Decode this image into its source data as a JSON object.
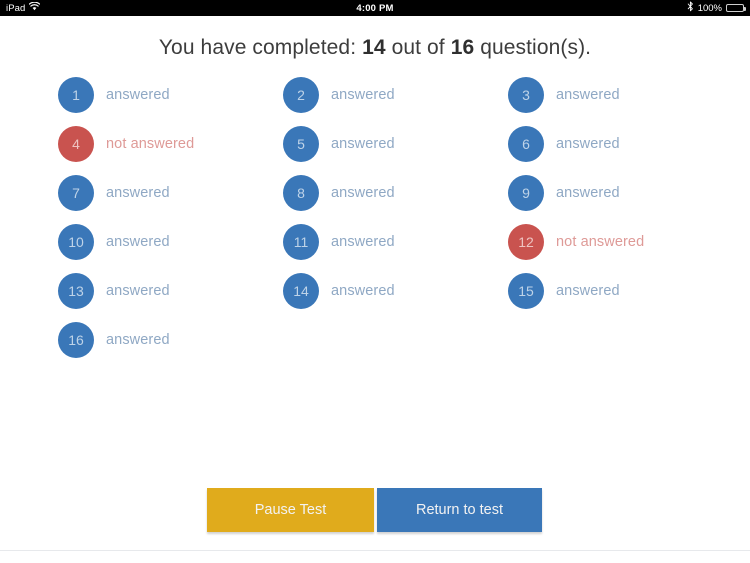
{
  "statusbar": {
    "device": "iPad",
    "wifi_icon": "wifi-icon",
    "time": "4:00 PM",
    "bluetooth_icon": "bluetooth-icon",
    "battery_percent": "100%",
    "battery_icon": "battery-full-icon"
  },
  "header": {
    "prefix": "You have completed:",
    "completed": "14",
    "middle": "out of",
    "total": "16",
    "suffix": "question(s)."
  },
  "questions": [
    {
      "number": "1",
      "status": "answered",
      "label": "answered"
    },
    {
      "number": "2",
      "status": "answered",
      "label": "answered"
    },
    {
      "number": "3",
      "status": "answered",
      "label": "answered"
    },
    {
      "number": "4",
      "status": "not_answered",
      "label": "not answered"
    },
    {
      "number": "5",
      "status": "answered",
      "label": "answered"
    },
    {
      "number": "6",
      "status": "answered",
      "label": "answered"
    },
    {
      "number": "7",
      "status": "answered",
      "label": "answered"
    },
    {
      "number": "8",
      "status": "answered",
      "label": "answered"
    },
    {
      "number": "9",
      "status": "answered",
      "label": "answered"
    },
    {
      "number": "10",
      "status": "answered",
      "label": "answered"
    },
    {
      "number": "11",
      "status": "answered",
      "label": "answered"
    },
    {
      "number": "12",
      "status": "not_answered",
      "label": "not answered"
    },
    {
      "number": "13",
      "status": "answered",
      "label": "answered"
    },
    {
      "number": "14",
      "status": "answered",
      "label": "answered"
    },
    {
      "number": "15",
      "status": "answered",
      "label": "answered"
    },
    {
      "number": "16",
      "status": "answered",
      "label": "answered"
    }
  ],
  "actions": {
    "pause_label": "Pause Test",
    "return_label": "Return to test"
  },
  "colors": {
    "answered_bubble": "#3a77b8",
    "not_answered_bubble": "#c9534f",
    "answered_text": "#8fa8c4",
    "not_answered_text": "#de9a97",
    "pause_button": "#e0ab1c",
    "return_button": "#3a77b8",
    "page_background": "#ffffff",
    "statusbar_background": "#000000"
  }
}
